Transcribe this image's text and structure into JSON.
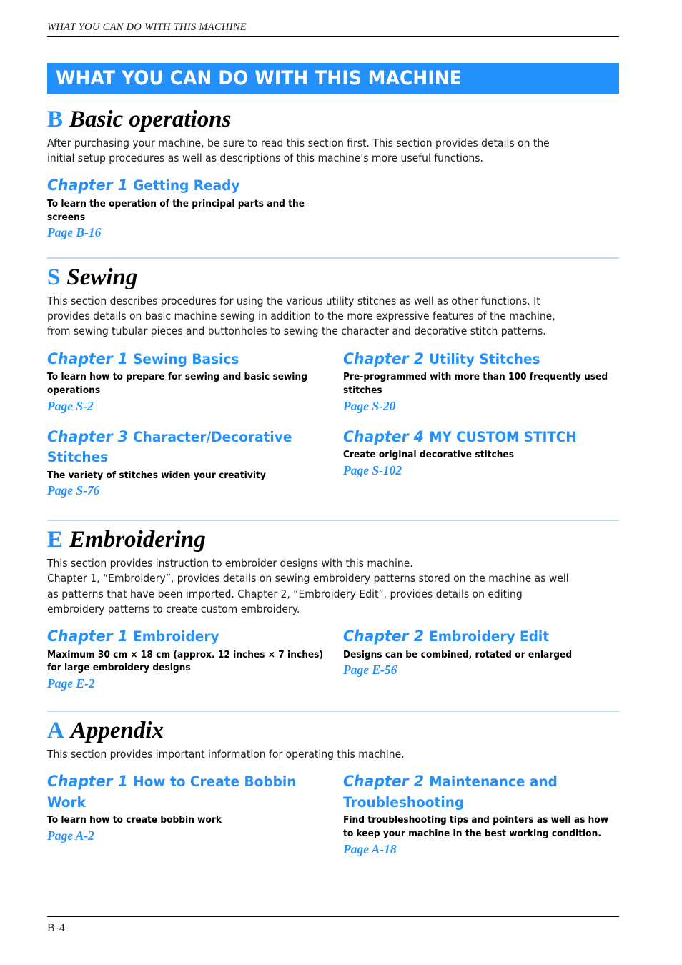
{
  "running_header": "WHAT YOU CAN DO WITH THIS MACHINE",
  "banner": {
    "title": "WHAT YOU CAN DO WITH THIS MACHINE",
    "color": "#2490fb"
  },
  "colors": {
    "accent_blue": "#2490fb",
    "rule_blue": "#b9d9f8",
    "text_black": "#000000"
  },
  "sections": [
    {
      "letter": "B",
      "name": "Basic operations",
      "description": "After purchasing your machine, be sure to read this section first. This section provides details on the\ninitial setup procedures as well as descriptions of this machine's more useful functions.",
      "chapters": [
        {
          "number": "Chapter 1",
          "name": "Getting Ready",
          "description": "To learn the operation of the principal parts and the\nscreens",
          "page": "Page B-16"
        }
      ]
    },
    {
      "letter": "S",
      "name": "Sewing",
      "description": "This section describes procedures for using the various utility stitches as well as other functions. It\nprovides details on basic machine sewing in addition to the more expressive features of the machine,\nfrom sewing tubular pieces and buttonholes to sewing the character and decorative stitch patterns.",
      "chapters": [
        {
          "number": "Chapter 1",
          "name": "Sewing Basics",
          "description": "To learn how to prepare for sewing and basic sewing\noperations",
          "page": "Page S-2"
        },
        {
          "number": "Chapter 2",
          "name": "Utility Stitches",
          "description": "Pre-programmed with more than 100 frequently used\nstitches",
          "page": "Page S-20"
        },
        {
          "number": "Chapter 3",
          "name": "Character/Decorative Stitches",
          "description": "The variety of stitches widen your creativity",
          "page": "Page S-76"
        },
        {
          "number": "Chapter 4",
          "name": "MY CUSTOM STITCH",
          "description": "Create original decorative stitches",
          "page": "Page S-102"
        }
      ]
    },
    {
      "letter": "E",
      "name": "Embroidering",
      "description": "This section provides instruction to embroider designs with this machine.\nChapter 1, “Embroidery”, provides details on sewing embroidery patterns stored on the machine as well\nas patterns that have been imported. Chapter 2, “Embroidery Edit”, provides details on editing\nembroidery patterns to create custom embroidery.",
      "chapters": [
        {
          "number": "Chapter 1",
          "name": "Embroidery",
          "description": "Maximum 30 cm × 18 cm (approx. 12 inches × 7 inches)\nfor large embroidery designs",
          "page": "Page E-2"
        },
        {
          "number": "Chapter 2",
          "name": "Embroidery Edit",
          "description": "Designs can be combined, rotated or enlarged",
          "page": "Page E-56"
        }
      ]
    },
    {
      "letter": "A",
      "name": "Appendix",
      "description": "This section provides important information for operating this machine.",
      "chapters": [
        {
          "number": "Chapter 1",
          "name": "How to Create Bobbin Work",
          "description": "To learn how to create bobbin work",
          "page": "Page A-2"
        },
        {
          "number": "Chapter 2",
          "name": "Maintenance and Troubleshooting",
          "description": "Find troubleshooting tips and pointers as well as how\nto keep your machine in the best working condition.",
          "page": "Page A-18"
        }
      ]
    }
  ],
  "footer": {
    "page_number": "B-4"
  }
}
